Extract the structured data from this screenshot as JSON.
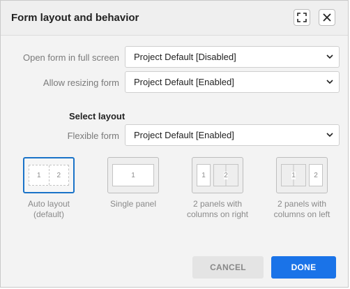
{
  "dialog": {
    "title": "Form layout and behavior",
    "expand_icon": "expand-icon",
    "close_icon": "close-icon"
  },
  "settings": [
    {
      "label": "Open form in full screen",
      "value": "Project Default [Disabled]"
    },
    {
      "label": "Allow resizing form",
      "value": "Project Default [Enabled]"
    }
  ],
  "layout_section": {
    "title": "Select layout",
    "flexible_label": "Flexible form",
    "flexible_value": "Project Default [Enabled]"
  },
  "layouts": [
    {
      "label_line1": "Auto layout",
      "label_line2": "(default)",
      "selected": true,
      "panes": [
        "1",
        "2"
      ]
    },
    {
      "label_line1": "Single panel",
      "label_line2": "",
      "selected": false,
      "panes": [
        "1"
      ]
    },
    {
      "label_line1": "2 panels with",
      "label_line2": "columns on right",
      "selected": false,
      "panes": [
        "1",
        "2"
      ]
    },
    {
      "label_line1": "2 panels with",
      "label_line2": "columns on left",
      "selected": false,
      "panes": [
        "1",
        "2"
      ]
    }
  ],
  "footer": {
    "cancel_label": "CANCEL",
    "done_label": "DONE"
  },
  "colors": {
    "accent": "#1a73e8",
    "selected_border": "#1a73c8"
  }
}
